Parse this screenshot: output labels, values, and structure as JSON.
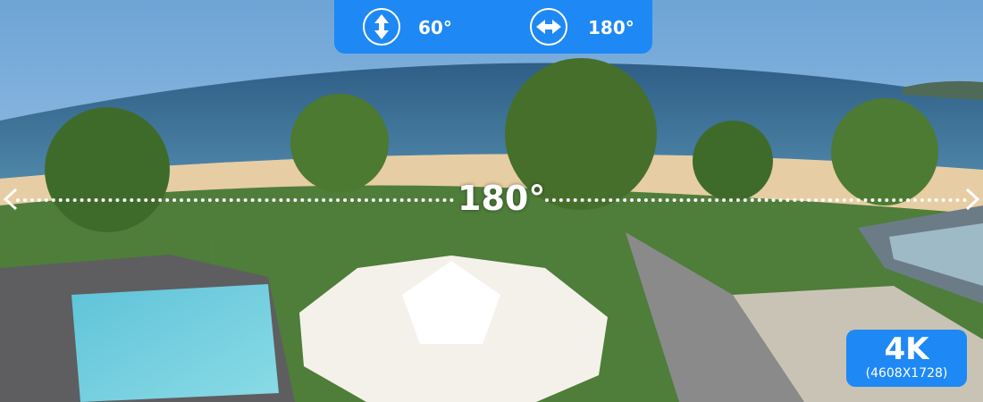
{
  "fov_bar": {
    "vertical": {
      "icon": "vertical-arrows-icon",
      "value": "60°"
    },
    "horizontal": {
      "icon": "horizontal-arrows-icon",
      "value": "180°"
    }
  },
  "panorama": {
    "angle_label": "180°",
    "left_icon": "chevron-left-icon",
    "right_icon": "chevron-right-icon"
  },
  "resolution_badge": {
    "label": "4K",
    "detail": "(4608X1728)"
  },
  "colors": {
    "accent": "#1e88f4",
    "text": "#ffffff"
  }
}
